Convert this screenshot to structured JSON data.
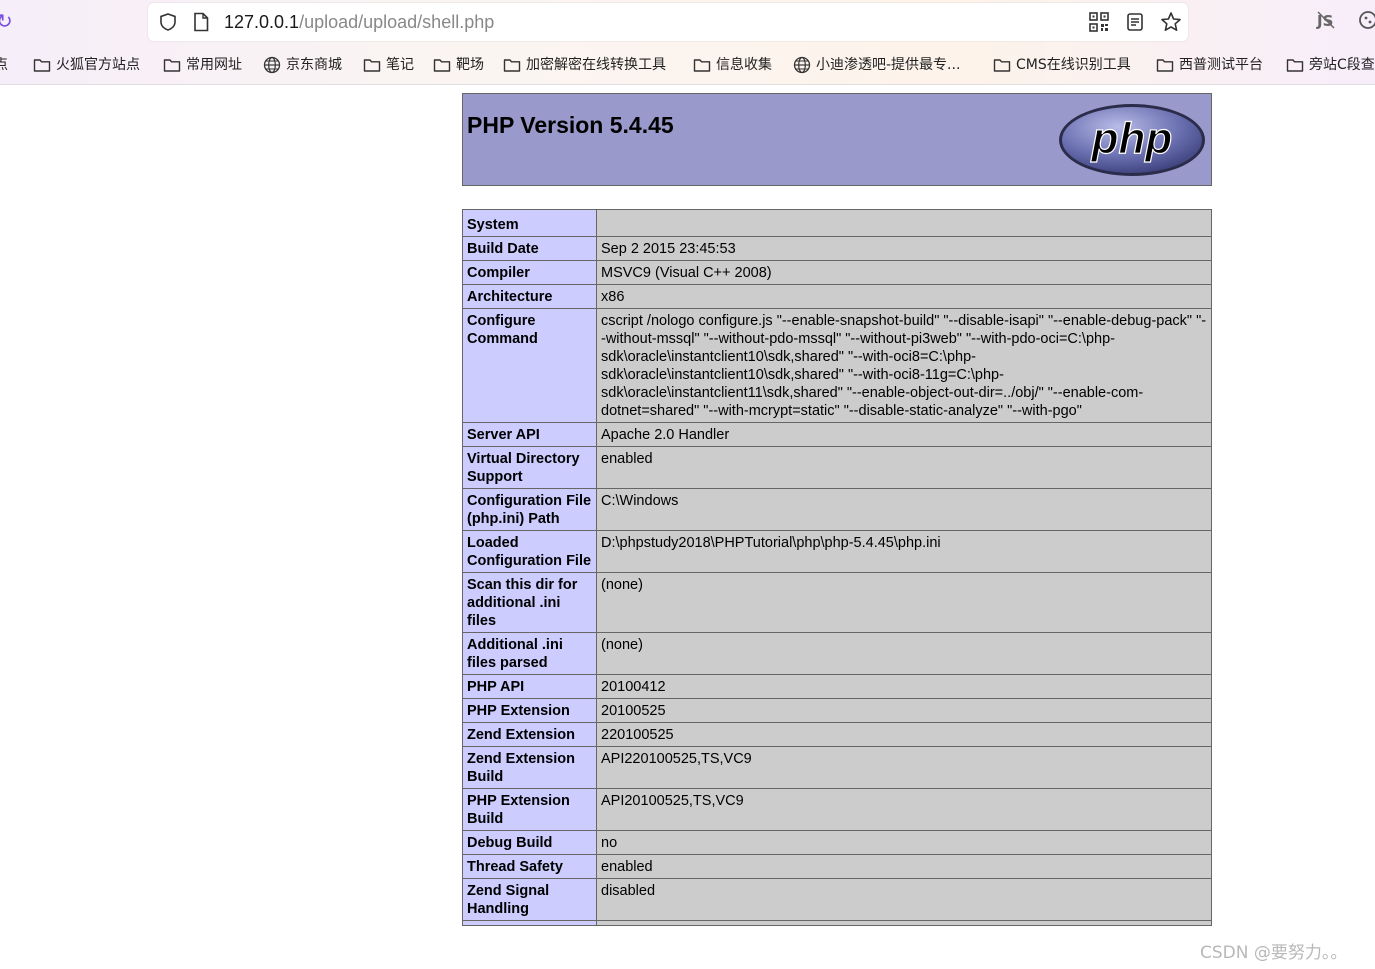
{
  "browser": {
    "url_host": "127.0.0.1",
    "url_path": "/upload/upload/shell.php",
    "bookmarks": [
      {
        "label": "点",
        "icon": "folder-icon"
      },
      {
        "label": "火狐官方站点",
        "icon": "folder-icon"
      },
      {
        "label": "常用网址",
        "icon": "folder-icon"
      },
      {
        "label": "京东商城",
        "icon": "globe-icon"
      },
      {
        "label": "笔记",
        "icon": "folder-icon"
      },
      {
        "label": "靶场",
        "icon": "folder-icon"
      },
      {
        "label": "加密解密在线转换工具",
        "icon": "folder-icon"
      },
      {
        "label": "信息收集",
        "icon": "folder-icon"
      },
      {
        "label": "小迪渗透吧-提供最专...",
        "icon": "globe-icon"
      },
      {
        "label": "CMS在线识别工具",
        "icon": "folder-icon"
      },
      {
        "label": "西普测试平台",
        "icon": "folder-icon"
      },
      {
        "label": "旁站C段查",
        "icon": "folder-icon"
      }
    ],
    "accent_color": "#7a4fe0"
  },
  "phpinfo": {
    "title": "PHP Version 5.4.45",
    "logo_text": "php",
    "header_color": "#9999cc",
    "key_color": "#ccccff",
    "value_color": "#cccccc",
    "rows": [
      {
        "key": "System",
        "value": ""
      },
      {
        "key": "Build Date",
        "value": "Sep 2 2015 23:45:53"
      },
      {
        "key": "Compiler",
        "value": "MSVC9 (Visual C++ 2008)"
      },
      {
        "key": "Architecture",
        "value": "x86"
      },
      {
        "key": "Configure Command",
        "value": "cscript /nologo configure.js \"--enable-snapshot-build\" \"--disable-isapi\" \"--enable-debug-pack\" \"--without-mssql\" \"--without-pdo-mssql\" \"--without-pi3web\" \"--with-pdo-oci=C:\\php-sdk\\oracle\\instantclient10\\sdk,shared\" \"--with-oci8=C:\\php-sdk\\oracle\\instantclient10\\sdk,shared\" \"--with-oci8-11g=C:\\php-sdk\\oracle\\instantclient11\\sdk,shared\" \"--enable-object-out-dir=../obj/\" \"--enable-com-dotnet=shared\" \"--with-mcrypt=static\" \"--disable-static-analyze\" \"--with-pgo\""
      },
      {
        "key": "Server API",
        "value": "Apache 2.0 Handler"
      },
      {
        "key": "Virtual Directory Support",
        "value": "enabled"
      },
      {
        "key": "Configuration File (php.ini) Path",
        "value": "C:\\Windows"
      },
      {
        "key": "Loaded Configuration File",
        "value": "D:\\phpstudy2018\\PHPTutorial\\php\\php-5.4.45\\php.ini"
      },
      {
        "key": "Scan this dir for additional .ini files",
        "value": "(none)"
      },
      {
        "key": "Additional .ini files parsed",
        "value": "(none)"
      },
      {
        "key": "PHP API",
        "value": "20100412"
      },
      {
        "key": "PHP Extension",
        "value": "20100525"
      },
      {
        "key": "Zend Extension",
        "value": "220100525"
      },
      {
        "key": "Zend Extension Build",
        "value": "API220100525,TS,VC9"
      },
      {
        "key": "PHP Extension Build",
        "value": "API20100525,TS,VC9"
      },
      {
        "key": "Debug Build",
        "value": "no"
      },
      {
        "key": "Thread Safety",
        "value": "enabled"
      },
      {
        "key": "Zend Signal Handling",
        "value": "disabled"
      },
      {
        "key": "",
        "value": ""
      }
    ]
  },
  "watermark": "CSDN @要努力。。"
}
